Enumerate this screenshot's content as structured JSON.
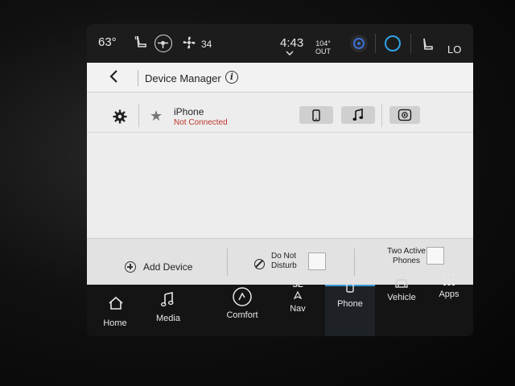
{
  "status": {
    "temp": "63°",
    "fan_level": "34",
    "time": "4:43",
    "outside_temp": "104°",
    "outside_label": "OUT",
    "climate_right": "LO"
  },
  "header": {
    "title": "Device Manager"
  },
  "devices": [
    {
      "name": "iPhone",
      "status": "Not Connected"
    }
  ],
  "bottom_bar": {
    "add_device": "Add Device",
    "dnd_line1": "Do Not",
    "dnd_line2": "Disturb",
    "two_active_line1": "Two Active",
    "two_active_line2": "Phones"
  },
  "nav": {
    "items": [
      {
        "label": "Home",
        "icon": "home-icon"
      },
      {
        "label": "Media",
        "icon": "music-note-icon"
      },
      {
        "label": "Comfort",
        "icon": "comfort-icon"
      },
      {
        "label": "Nav",
        "icon": "compass-icon",
        "heading": "SE"
      },
      {
        "label": "Phone",
        "icon": "phone-icon"
      },
      {
        "label": "Vehicle",
        "icon": "car-icon"
      },
      {
        "label": "Apps",
        "icon": "apps-grid-icon"
      }
    ]
  },
  "colors": {
    "accent": "#3a9ad9",
    "warning_text": "#c0362c",
    "alexa": "#2fa3e6"
  }
}
